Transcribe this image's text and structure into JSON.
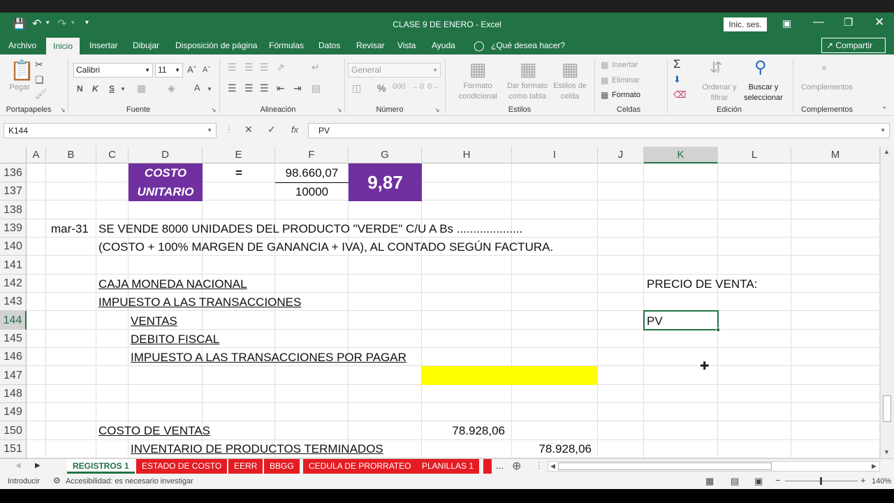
{
  "window": {
    "title": "CLASE 9 DE ENERO  -  Excel",
    "sign_in": "Inic. ses.",
    "share": "Compartir"
  },
  "ribbon_tabs": [
    "Archivo",
    "Inicio",
    "Insertar",
    "Dibujar",
    "Disposición de página",
    "Fórmulas",
    "Datos",
    "Revisar",
    "Vista",
    "Ayuda"
  ],
  "tell_me": "¿Qué desea hacer?",
  "ribbon": {
    "paste_label": "Pegar",
    "font_name": "Calibri",
    "font_size": "11",
    "bold": "N",
    "italic": "K",
    "underline": "S",
    "number_format": "General",
    "conditional_format": "Formato condicional",
    "format_as_table": "Dar formato como tabla",
    "cell_styles": "Estilos de celda",
    "insert": "Insertar",
    "delete": "Eliminar",
    "format": "Formato",
    "sort_filter": "Ordenar y filtrar",
    "find_select": "Buscar y seleccionar",
    "addins": "Complementos",
    "groups": [
      "Portapapeles",
      "Fuente",
      "Alineación",
      "Número",
      "Estilos",
      "Celdas",
      "Edición",
      "Complementos"
    ]
  },
  "formula_bar": {
    "name_box": "K144",
    "formula": "PV",
    "fx": "fx"
  },
  "columns": [
    "A",
    "B",
    "C",
    "D",
    "E",
    "F",
    "G",
    "H",
    "I",
    "J",
    "K",
    "L",
    "M"
  ],
  "rows": [
    "136",
    "137",
    "138",
    "139",
    "140",
    "141",
    "142",
    "143",
    "144",
    "145",
    "146",
    "147",
    "148",
    "149",
    "150",
    "151"
  ],
  "selected_cell": {
    "column": "K",
    "row": "144"
  },
  "cells": {
    "costo": "COSTO",
    "unitario": "UNITARIO",
    "equals": "=",
    "numerator": "98.660,07",
    "denominator": "10000",
    "result": "9,87",
    "date": "mar-31",
    "line139": "SE VENDE 8000 UNIDADES DEL PRODUCTO \"VERDE\" C/U A Bs ....................",
    "line140": "(COSTO + 100% MARGEN DE GANANCIA + IVA), AL CONTADO SEGÚN FACTURA.",
    "caja": "CAJA MONEDA NACIONAL",
    "impuesto": "IMPUESTO A LAS TRANSACCIONES",
    "ventas": "VENTAS",
    "debito": "DEBITO FISCAL",
    "itpagar": "IMPUESTO A LAS TRANSACCIONES POR PAGAR",
    "costo_ventas": "COSTO DE VENTAS",
    "inventario": "INVENTARIO DE PRODUCTOS TERMINADOS",
    "h150": "78.928,06",
    "i151": "78.928,06",
    "precio_venta": "PRECIO DE VENTA:",
    "k144": "PV"
  },
  "colors": {
    "excel_green": "#217346",
    "purple_fill": "#7030a0",
    "yellow_fill": "#ffff00",
    "tab_red": "#e51c23"
  },
  "sheet_tabs": [
    "REGISTROS 1",
    "ESTADO DE COSTO",
    "EERR",
    "BBGG",
    "CEDULA DE PRORRATEO",
    "PLANILLAS 1"
  ],
  "sheet_tabs_more": "...",
  "status": {
    "mode": "Introducir",
    "accessibility": "Accesibilidad: es necesario investigar",
    "zoom": "140%"
  }
}
